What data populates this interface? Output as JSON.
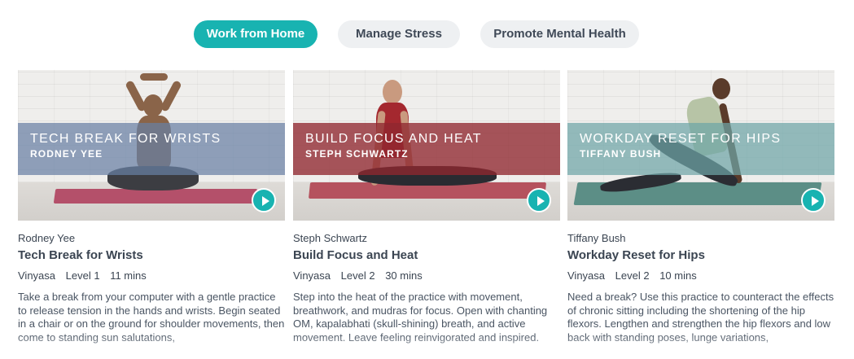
{
  "tabs": [
    {
      "label": "Work from Home",
      "active": true
    },
    {
      "label": "Manage Stress",
      "active": false
    },
    {
      "label": "Promote Mental Health",
      "active": false
    }
  ],
  "colors": {
    "accent": "#18b3b1",
    "band_blue": "#687fa3",
    "band_red": "#8f2830",
    "band_teal": "#6ea5a6"
  },
  "cards": [
    {
      "band_title": "TECH BREAK FOR WRISTS",
      "band_teacher": "RODNEY YEE",
      "teacher": "Rodney Yee",
      "title": "Tech Break for Wrists",
      "style": "Vinyasa",
      "level": "Level 1",
      "duration": "11 mins",
      "description": "Take a break from your computer with a gentle practice to release tension in the hands and wrists. Begin seated in a chair or on the ground for shoulder movements, then come to standing sun salutations,"
    },
    {
      "band_title": "BUILD FOCUS AND HEAT",
      "band_teacher": "STEPH SCHWARTZ",
      "teacher": "Steph Schwartz",
      "title": "Build Focus and Heat",
      "style": "Vinyasa",
      "level": "Level 2",
      "duration": "30 mins",
      "description": "Step into the heat of the practice with movement, breathwork, and mudras for focus. Open with chanting OM, kapalabhati (skull-shining) breath, and active movement. Leave feeling reinvigorated and inspired."
    },
    {
      "band_title": "WORKDAY RESET FOR HIPS",
      "band_teacher": "TIFFANY BUSH",
      "teacher": "Tiffany Bush",
      "title": "Workday Reset for Hips",
      "style": "Vinyasa",
      "level": "Level 2",
      "duration": "10 mins",
      "description": "Need a break? Use this practice to counteract the effects of chronic sitting including the shortening of the hip flexors. Lengthen and strengthen the hip flexors and low back with standing poses, lunge variations,"
    }
  ]
}
